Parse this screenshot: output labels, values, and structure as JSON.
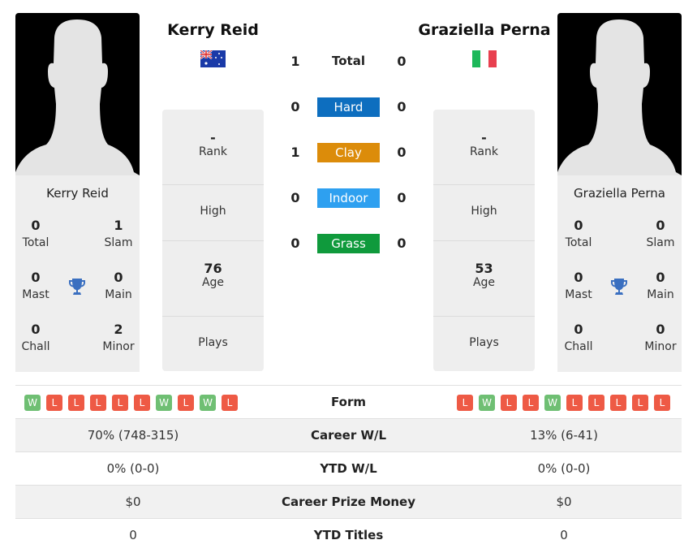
{
  "players": {
    "left": {
      "name": "Kerry Reid",
      "country": "Australia",
      "flag": "australia-flag",
      "titles": {
        "total": {
          "value": "0",
          "label": "Total"
        },
        "slam": {
          "value": "1",
          "label": "Slam"
        },
        "mast": {
          "value": "0",
          "label": "Mast"
        },
        "main": {
          "value": "0",
          "label": "Main"
        },
        "chall": {
          "value": "0",
          "label": "Chall"
        },
        "minor": {
          "value": "2",
          "label": "Minor"
        }
      },
      "info": {
        "rank": {
          "value": "-",
          "label": "Rank"
        },
        "high": {
          "value": "",
          "label": "High"
        },
        "age": {
          "value": "76",
          "label": "Age"
        },
        "plays": {
          "value": "",
          "label": "Plays"
        }
      },
      "form": [
        "W",
        "L",
        "L",
        "L",
        "L",
        "L",
        "W",
        "L",
        "W",
        "L"
      ]
    },
    "right": {
      "name": "Graziella Perna",
      "country": "Italy",
      "flag": "italy-flag",
      "titles": {
        "total": {
          "value": "0",
          "label": "Total"
        },
        "slam": {
          "value": "0",
          "label": "Slam"
        },
        "mast": {
          "value": "0",
          "label": "Mast"
        },
        "main": {
          "value": "0",
          "label": "Main"
        },
        "chall": {
          "value": "0",
          "label": "Chall"
        },
        "minor": {
          "value": "0",
          "label": "Minor"
        }
      },
      "info": {
        "rank": {
          "value": "-",
          "label": "Rank"
        },
        "high": {
          "value": "",
          "label": "High"
        },
        "age": {
          "value": "53",
          "label": "Age"
        },
        "plays": {
          "value": "",
          "label": "Plays"
        }
      },
      "form": [
        "L",
        "W",
        "L",
        "L",
        "W",
        "L",
        "L",
        "L",
        "L",
        "L"
      ]
    }
  },
  "h2h": [
    {
      "label": "Total",
      "left": "1",
      "right": "0",
      "color": null
    },
    {
      "label": "Hard",
      "left": "0",
      "right": "0",
      "color": "#0d6ebf"
    },
    {
      "label": "Clay",
      "left": "1",
      "right": "0",
      "color": "#dc8c0a"
    },
    {
      "label": "Indoor",
      "left": "0",
      "right": "0",
      "color": "#2ea0f0"
    },
    {
      "label": "Grass",
      "left": "0",
      "right": "0",
      "color": "#0f9a3c"
    }
  ],
  "stats": {
    "form_label": "Form",
    "rows": [
      {
        "label": "Career W/L",
        "left": "70% (748-315)",
        "right": "13% (6-41)"
      },
      {
        "label": "YTD W/L",
        "left": "0% (0-0)",
        "right": "0% (0-0)"
      },
      {
        "label": "Career Prize Money",
        "left": "$0",
        "right": "$0"
      },
      {
        "label": "YTD Titles",
        "left": "0",
        "right": "0"
      }
    ]
  },
  "colors": {
    "win": "#6fbf73",
    "loss": "#ee5a45",
    "trophy": "#3a6fc0"
  }
}
